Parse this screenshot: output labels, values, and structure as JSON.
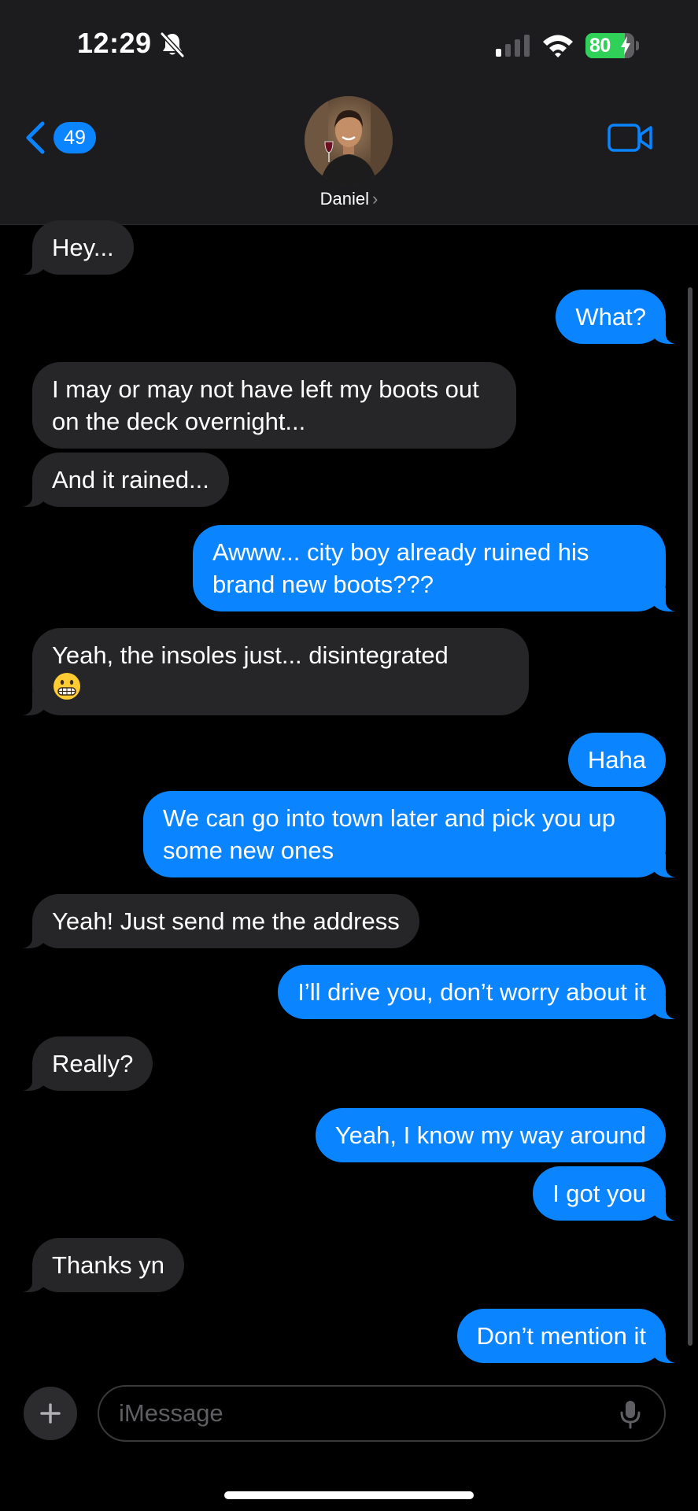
{
  "status_bar": {
    "time": "12:29",
    "battery_percent": "80",
    "battery_level": 0.8,
    "signal_bars_active": 1,
    "icons": [
      "bell-slash-icon",
      "cellular-signal-icon",
      "wifi-icon",
      "battery-icon",
      "charging-bolt-icon"
    ]
  },
  "header": {
    "back_icon": "chevron-left-icon",
    "unread_count": "49",
    "contact_name": "Daniel",
    "name_chevron": "›",
    "video_icon": "video-camera-icon"
  },
  "colors": {
    "incoming_bubble": "#262628",
    "outgoing_bubble": "#0a84ff",
    "background": "#000000",
    "header_background": "#1c1c1e"
  },
  "messages": [
    {
      "direction": "incoming",
      "text": "Hey..."
    },
    {
      "direction": "outgoing",
      "text": "What?"
    },
    {
      "direction": "incoming",
      "text": "I may or may not have left my boots out on the deck overnight..."
    },
    {
      "direction": "incoming",
      "text": "And it rained..."
    },
    {
      "direction": "outgoing",
      "text": "Awww... city boy already ruined his brand new boots???"
    },
    {
      "direction": "incoming",
      "text": "Yeah, the insoles just... disintegrated",
      "emoji": "grimacing-face"
    },
    {
      "direction": "outgoing",
      "text": "Haha"
    },
    {
      "direction": "outgoing",
      "text": "We can go into town later and pick you up some new ones"
    },
    {
      "direction": "incoming",
      "text": "Yeah! Just send me the address"
    },
    {
      "direction": "outgoing",
      "text": "I’ll drive you, don’t worry about it"
    },
    {
      "direction": "incoming",
      "text": "Really?"
    },
    {
      "direction": "outgoing",
      "text": "Yeah, I know my way around"
    },
    {
      "direction": "outgoing",
      "text": "I got you"
    },
    {
      "direction": "incoming",
      "text": "Thanks yn"
    },
    {
      "direction": "outgoing",
      "text": "Don’t mention it"
    }
  ],
  "composer": {
    "placeholder": "iMessage",
    "value": "",
    "plus_icon": "plus-icon",
    "mic_icon": "microphone-icon"
  }
}
